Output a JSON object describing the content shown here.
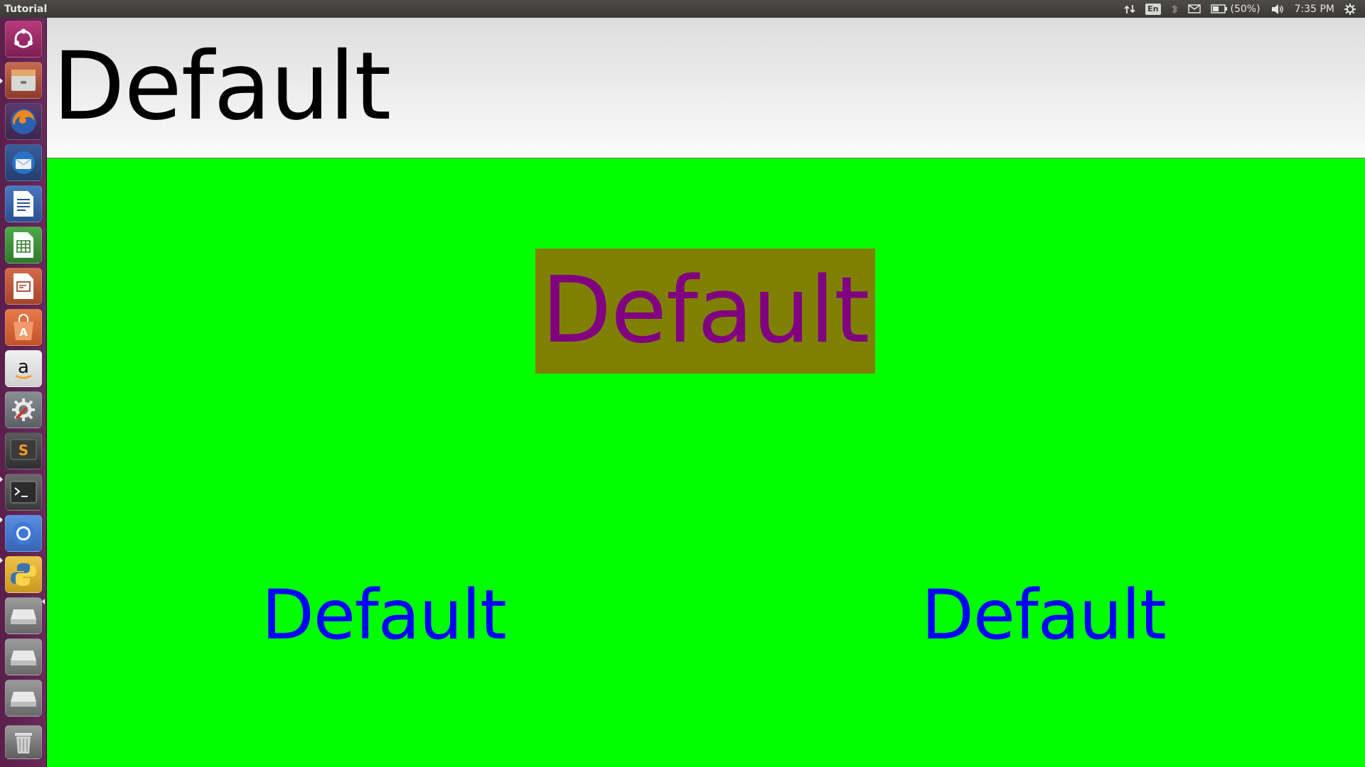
{
  "top_panel": {
    "window_title": "Tutorial",
    "keyboard_layout": "En",
    "battery_percent": "(50%)",
    "clock": "7:35 PM",
    "indicator_icons": [
      "network-transfer-icon",
      "keyboard-layout-icon",
      "bluetooth-icon",
      "mail-icon",
      "battery-icon",
      "volume-icon",
      "gear-icon"
    ]
  },
  "launcher": {
    "items": [
      {
        "name": "ubuntu-dash-icon"
      },
      {
        "name": "files-icon"
      },
      {
        "name": "firefox-icon"
      },
      {
        "name": "thunderbird-icon"
      },
      {
        "name": "libreoffice-writer-icon"
      },
      {
        "name": "libreoffice-calc-icon"
      },
      {
        "name": "libreoffice-impress-icon"
      },
      {
        "name": "software-center-icon"
      },
      {
        "name": "amazon-icon"
      },
      {
        "name": "system-settings-icon"
      },
      {
        "name": "sublime-text-icon"
      },
      {
        "name": "terminal-icon"
      },
      {
        "name": "chromium-icon"
      },
      {
        "name": "python-icon"
      },
      {
        "name": "drive-icon"
      },
      {
        "name": "drive-icon"
      },
      {
        "name": "drive-icon"
      },
      {
        "name": "trash-icon"
      }
    ]
  },
  "app": {
    "header_label": "Default",
    "center_label": "Default",
    "bottom_left_label": "Default",
    "bottom_right_label": "Default",
    "colors": {
      "background": "#00ff00",
      "center_label_background": "#808000",
      "center_label_text": "#800080",
      "bottom_label_text": "#0000ff",
      "header_text": "#000000"
    }
  }
}
